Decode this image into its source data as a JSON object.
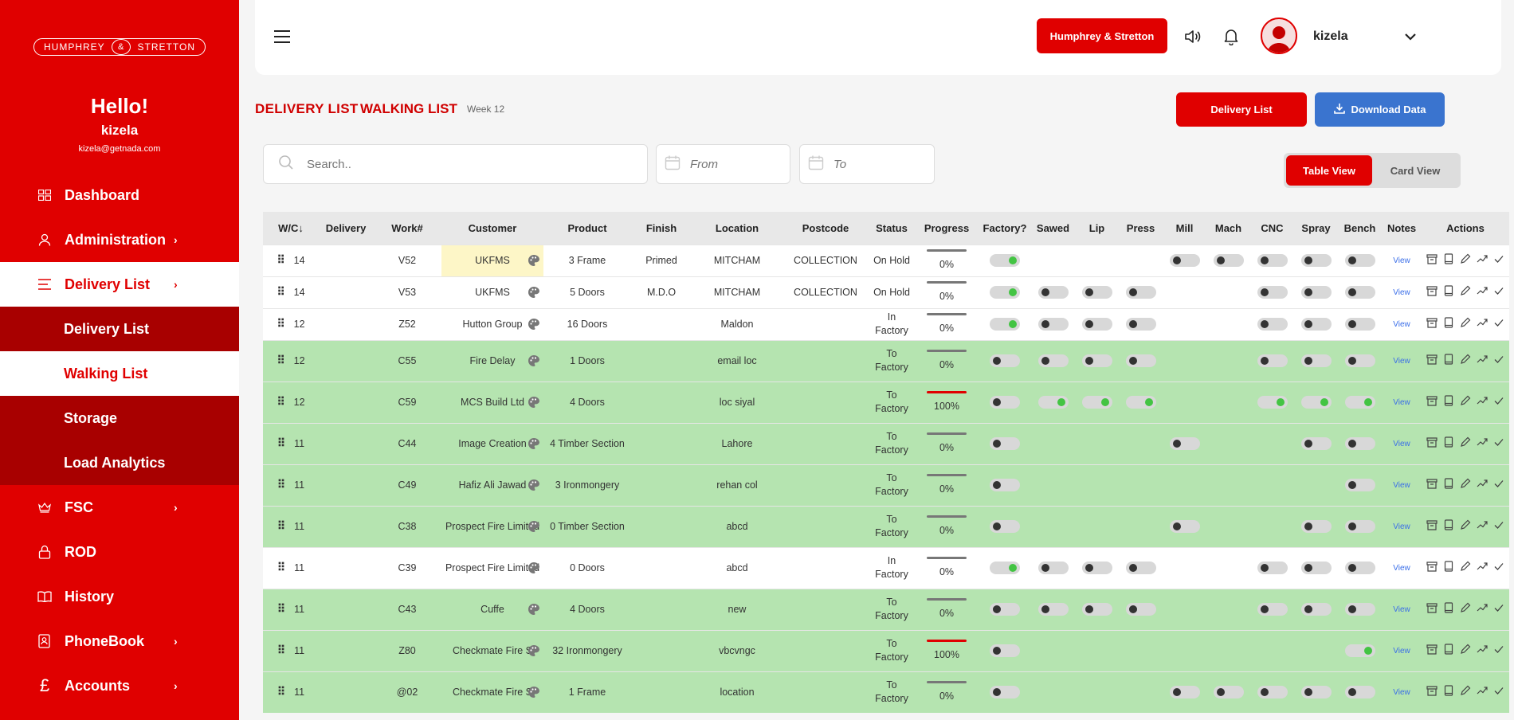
{
  "brand": {
    "logo_left": "HUMPHREY",
    "logo_amp": "&",
    "logo_right": "STRETTON"
  },
  "sidebar": {
    "greeting": "Hello!",
    "username": "kizela",
    "email": "kizela@getnada.com",
    "items": [
      {
        "label": "Dashboard",
        "icon": "dashboard-icon"
      },
      {
        "label": "Administration",
        "icon": "user-icon"
      },
      {
        "label": "Delivery List",
        "icon": "list-icon"
      },
      {
        "label": "FSC",
        "icon": "crown-icon"
      },
      {
        "label": "ROD",
        "icon": "lock-icon"
      },
      {
        "label": "History",
        "icon": "book-icon"
      },
      {
        "label": "PhoneBook",
        "icon": "phonebook-icon"
      },
      {
        "label": "Accounts",
        "icon": "pound-icon"
      }
    ],
    "sub_items": [
      "Delivery List",
      "Walking List",
      "Storage",
      "Load Analytics"
    ],
    "chevron": "›"
  },
  "header": {
    "company_button": "Humphrey & Stretton",
    "user": "kizela"
  },
  "titlebar": {
    "delivery": "DELIVERY LIST",
    "walking": "WALKING LIST",
    "week": "Week 12",
    "delivery_btn": "Delivery List",
    "download_btn": "Download Data"
  },
  "filters": {
    "search_placeholder": "Search..",
    "from_placeholder": "From",
    "to_placeholder": "To",
    "table_view": "Table View",
    "card_view": "Card View"
  },
  "table": {
    "columns": [
      "W/C",
      "Delivery",
      "Work#",
      "Customer",
      "Product",
      "Finish",
      "Location",
      "Postcode",
      "Status",
      "Progress",
      "Factory?",
      "Sawed",
      "Lip",
      "Press",
      "Mill",
      "Mach",
      "CNC",
      "Spray",
      "Bench",
      "Notes",
      "Actions"
    ],
    "sort_arrow": "↓",
    "view_label": "View",
    "rows": [
      {
        "wc": "14",
        "delivery": "",
        "work": "V52",
        "customer": "UKFMS",
        "product": "3 Frame",
        "finish": "Primed",
        "location": "MITCHAM",
        "postcode": "COLLECTION",
        "status": "On Hold",
        "progress": "0%"
      },
      {
        "wc": "14",
        "delivery": "",
        "work": "V53",
        "customer": "UKFMS",
        "product": "5 Doors",
        "finish": "M.D.O",
        "location": "MITCHAM",
        "postcode": "COLLECTION",
        "status": "On Hold",
        "progress": "0%"
      },
      {
        "wc": "12",
        "delivery": "",
        "work": "Z52",
        "customer": "Hutton Group",
        "product": "16 Doors",
        "finish": "",
        "location": "Maldon",
        "postcode": "",
        "status": "In Factory",
        "progress": "0%"
      },
      {
        "wc": "12",
        "delivery": "",
        "work": "C55",
        "customer": "Fire Delay",
        "product": "1 Doors",
        "finish": "",
        "location": "email loc",
        "postcode": "",
        "status": "To Factory",
        "progress": "0%"
      },
      {
        "wc": "12",
        "delivery": "",
        "work": "C59",
        "customer": "MCS Build Ltd",
        "product": "4 Doors",
        "finish": "",
        "location": "loc siyal",
        "postcode": "",
        "status": "To Factory",
        "progress": "100%"
      },
      {
        "wc": "11",
        "delivery": "",
        "work": "C44",
        "customer": "Image Creation",
        "product": "4 Timber Section",
        "finish": "",
        "location": "Lahore",
        "postcode": "",
        "status": "To Factory",
        "progress": "0%"
      },
      {
        "wc": "11",
        "delivery": "",
        "work": "C49",
        "customer": "Hafiz Ali Jawad",
        "product": "3 Ironmongery",
        "finish": "",
        "location": "rehan col",
        "postcode": "",
        "status": "To Factory",
        "progress": "0%"
      },
      {
        "wc": "11",
        "delivery": "",
        "work": "C38",
        "customer": "Prospect Fire Limited",
        "product": "0 Timber Section",
        "finish": "",
        "location": "abcd",
        "postcode": "",
        "status": "To Factory",
        "progress": "0%"
      },
      {
        "wc": "11",
        "delivery": "",
        "work": "C39",
        "customer": "Prospect Fire Limited",
        "product": "0 Doors",
        "finish": "",
        "location": "abcd",
        "postcode": "",
        "status": "In Factory",
        "progress": "0%"
      },
      {
        "wc": "11",
        "delivery": "",
        "work": "C43",
        "customer": "Cuffe",
        "product": "4 Doors",
        "finish": "",
        "location": "new",
        "postcode": "",
        "status": "To Factory",
        "progress": "0%"
      },
      {
        "wc": "11",
        "delivery": "",
        "work": "Z80",
        "customer": "Checkmate Fire S",
        "product": "32 Ironmongery",
        "finish": "",
        "location": "vbcvngc",
        "postcode": "",
        "status": "To Factory",
        "progress": "100%"
      },
      {
        "wc": "11",
        "delivery": "",
        "work": "@02",
        "customer": "Checkmate Fire S",
        "product": "1 Frame",
        "finish": "",
        "location": "location",
        "postcode": "",
        "status": "To Factory",
        "progress": "0%"
      }
    ]
  },
  "colors": {
    "brand_red": "#e00000",
    "dark_red": "#a80000",
    "row_green": "#b5e4b0",
    "download_blue": "#3a74cf",
    "toggle_on": "#43c443"
  }
}
